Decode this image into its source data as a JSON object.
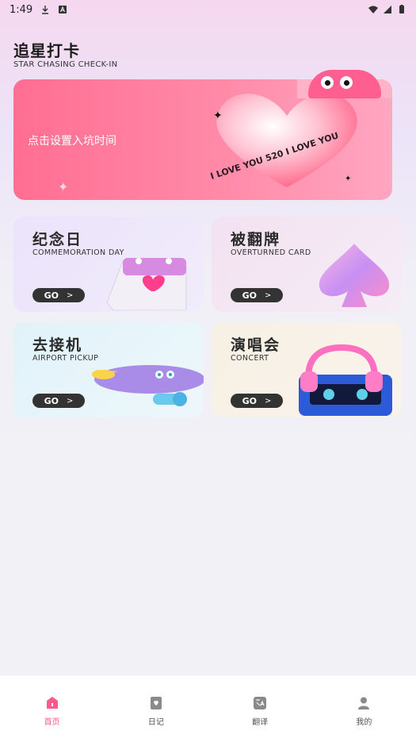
{
  "status_bar": {
    "time": "1:49",
    "icons_left": [
      "download-icon",
      "font-icon"
    ],
    "icons_right": [
      "wifi-icon",
      "signal-icon",
      "battery-icon"
    ]
  },
  "header": {
    "title": "追星打卡",
    "subtitle": "STAR CHASING CHECK-IN"
  },
  "banner": {
    "label": "点击设置入坑时间",
    "heart_text": "I LOVE YOU 520 I LOVE YOU",
    "accent_color": "#ff6e93"
  },
  "cards": [
    {
      "title": "纪念日",
      "subtitle": "COMMEMORATION DAY",
      "button": "GO",
      "arrow": ">",
      "illustration": "calendar-icon",
      "bg": "#ece6fb"
    },
    {
      "title": "被翻牌",
      "subtitle": "OVERTURNED CARD",
      "button": "GO",
      "arrow": ">",
      "illustration": "spade-card-icon",
      "bg": "#f4e6f4"
    },
    {
      "title": "去接机",
      "subtitle": "AIRPORT PICKUP",
      "button": "GO",
      "arrow": ">",
      "illustration": "airplane-icon",
      "bg": "#e3f2f8"
    },
    {
      "title": "演唱会",
      "subtitle": "CONCERT",
      "button": "GO",
      "arrow": ">",
      "illustration": "cassette-headphones-icon",
      "bg": "#f7f2ea"
    }
  ],
  "bottom_nav": {
    "items": [
      {
        "label": "首页",
        "icon": "home-icon",
        "active": true
      },
      {
        "label": "日记",
        "icon": "diary-icon",
        "active": false
      },
      {
        "label": "翻译",
        "icon": "translate-icon",
        "active": false
      },
      {
        "label": "我的",
        "icon": "user-icon",
        "active": false
      }
    ],
    "active_color": "#ff5a8c"
  }
}
